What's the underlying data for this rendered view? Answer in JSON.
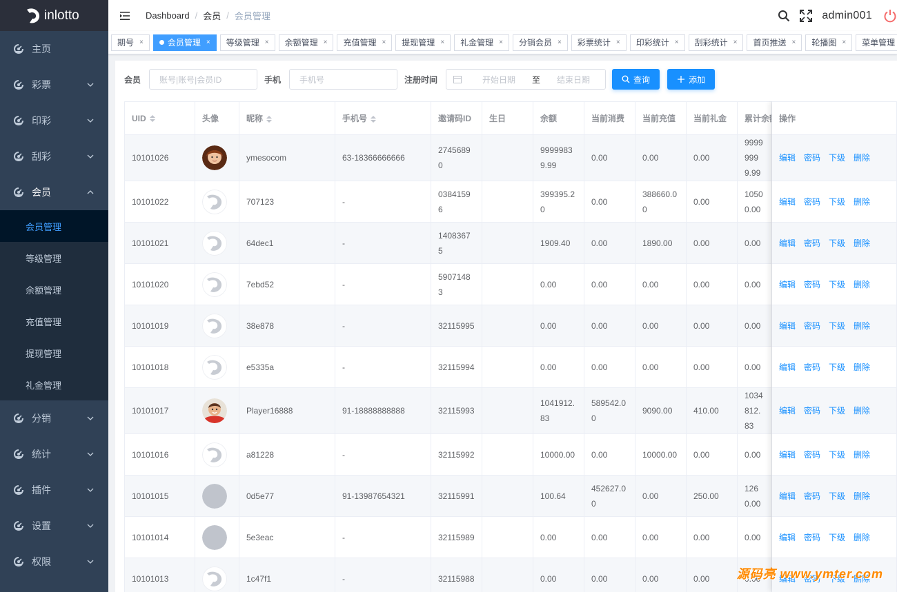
{
  "app": {
    "name": "inlotto"
  },
  "sidebar": {
    "items": [
      {
        "label": "主页",
        "has_children": false
      },
      {
        "label": "彩票",
        "has_children": true
      },
      {
        "label": "印彩",
        "has_children": true
      },
      {
        "label": "刮彩",
        "has_children": true
      },
      {
        "label": "会员",
        "has_children": true,
        "open": true,
        "children": [
          "会员管理",
          "等级管理",
          "余额管理",
          "充值管理",
          "提现管理",
          "礼金管理"
        ]
      },
      {
        "label": "分销",
        "has_children": true
      },
      {
        "label": "统计",
        "has_children": true
      },
      {
        "label": "插件",
        "has_children": true
      },
      {
        "label": "设置",
        "has_children": true
      },
      {
        "label": "权限",
        "has_children": true
      }
    ],
    "active_child": "会员管理"
  },
  "navbar": {
    "breadcrumb": [
      "Dashboard",
      "会员",
      "会员管理"
    ],
    "username": "admin001"
  },
  "tags": [
    "期号",
    "会员管理",
    "等级管理",
    "余额管理",
    "充值管理",
    "提现管理",
    "礼金管理",
    "分销会员",
    "彩票统计",
    "印彩统计",
    "刮彩统计",
    "首页推送",
    "轮播图",
    "菜单管理"
  ],
  "active_tag": "会员管理",
  "filter": {
    "member_label": "会员",
    "member_placeholder": "账号|账号|会员ID",
    "phone_label": "手机",
    "phone_placeholder": "手机号",
    "reg_label": "注册时间",
    "start_placeholder": "开始日期",
    "range_sep": "至",
    "end_placeholder": "结束日期",
    "search_btn": "查询",
    "add_btn": "添加"
  },
  "table": {
    "columns": [
      "UID",
      "头像",
      "昵称",
      "手机号",
      "邀请码ID",
      "生日",
      "余额",
      "当前消费",
      "当前充值",
      "当前礼金",
      "累计余额",
      "操作"
    ],
    "sortable": [
      "UID",
      "昵称",
      "手机号"
    ],
    "actions": [
      "编辑",
      "密码",
      "下级",
      "删除"
    ],
    "rows": [
      {
        "uid": "10101026",
        "avatar": "photo-woman",
        "nickname": "ymesocom",
        "phone": "63-18366666666",
        "invite": "27456890",
        "birthday": "",
        "balance": "99999839.99",
        "consume": "0.00",
        "recharge": "0.00",
        "gift": "0.00",
        "total": "99999999.99"
      },
      {
        "uid": "10101022",
        "avatar": "logo",
        "nickname": "707123",
        "phone": "-",
        "invite": "03841596",
        "birthday": "",
        "balance": "399395.20",
        "consume": "0.00",
        "recharge": "388660.00",
        "gift": "0.00",
        "total": "10500.00"
      },
      {
        "uid": "10101021",
        "avatar": "logo",
        "nickname": "64dec1",
        "phone": "-",
        "invite": "14083675",
        "birthday": "",
        "balance": "1909.40",
        "consume": "0.00",
        "recharge": "1890.00",
        "gift": "0.00",
        "total": "0.00"
      },
      {
        "uid": "10101020",
        "avatar": "logo",
        "nickname": "7ebd52",
        "phone": "-",
        "invite": "59071483",
        "birthday": "",
        "balance": "0.00",
        "consume": "0.00",
        "recharge": "0.00",
        "gift": "0.00",
        "total": "0.00"
      },
      {
        "uid": "10101019",
        "avatar": "logo",
        "nickname": "38e878",
        "phone": "-",
        "invite": "32115995",
        "birthday": "",
        "balance": "0.00",
        "consume": "0.00",
        "recharge": "0.00",
        "gift": "0.00",
        "total": "0.00"
      },
      {
        "uid": "10101018",
        "avatar": "logo",
        "nickname": "e5335a",
        "phone": "-",
        "invite": "32115994",
        "birthday": "",
        "balance": "0.00",
        "consume": "0.00",
        "recharge": "0.00",
        "gift": "0.00",
        "total": "0.00"
      },
      {
        "uid": "10101017",
        "avatar": "photo-child",
        "nickname": "Player16888",
        "phone": "91-18888888888",
        "invite": "32115993",
        "birthday": "",
        "balance": "1041912.83",
        "consume": "589542.00",
        "recharge": "9090.00",
        "gift": "410.00",
        "total": "1034812.83"
      },
      {
        "uid": "10101016",
        "avatar": "logo",
        "nickname": "a81228",
        "phone": "-",
        "invite": "32115992",
        "birthday": "",
        "balance": "10000.00",
        "consume": "0.00",
        "recharge": "10000.00",
        "gift": "0.00",
        "total": "0.00"
      },
      {
        "uid": "10101015",
        "avatar": "blank",
        "nickname": "0d5e77",
        "phone": "91-13987654321",
        "invite": "32115991",
        "birthday": "",
        "balance": "100.64",
        "consume": "452627.00",
        "recharge": "0.00",
        "gift": "250.00",
        "total": "1260.00"
      },
      {
        "uid": "10101014",
        "avatar": "blank",
        "nickname": "5e3eac",
        "phone": "-",
        "invite": "32115989",
        "birthday": "",
        "balance": "0.00",
        "consume": "0.00",
        "recharge": "0.00",
        "gift": "0.00",
        "total": "0.00"
      },
      {
        "uid": "10101013",
        "avatar": "logo",
        "nickname": "1c47f1",
        "phone": "-",
        "invite": "32115988",
        "birthday": "",
        "balance": "0.00",
        "consume": "0.00",
        "recharge": "0.00",
        "gift": "0.00",
        "total": "0.00"
      }
    ]
  },
  "watermark": "源码亮 www.ymter.com",
  "colors": {
    "primary": "#1890ff",
    "sidebar_bg": "#304156",
    "submenu_bg": "#1f2d3d",
    "active_sub_bg": "#001528",
    "power": "#f56c6c"
  }
}
